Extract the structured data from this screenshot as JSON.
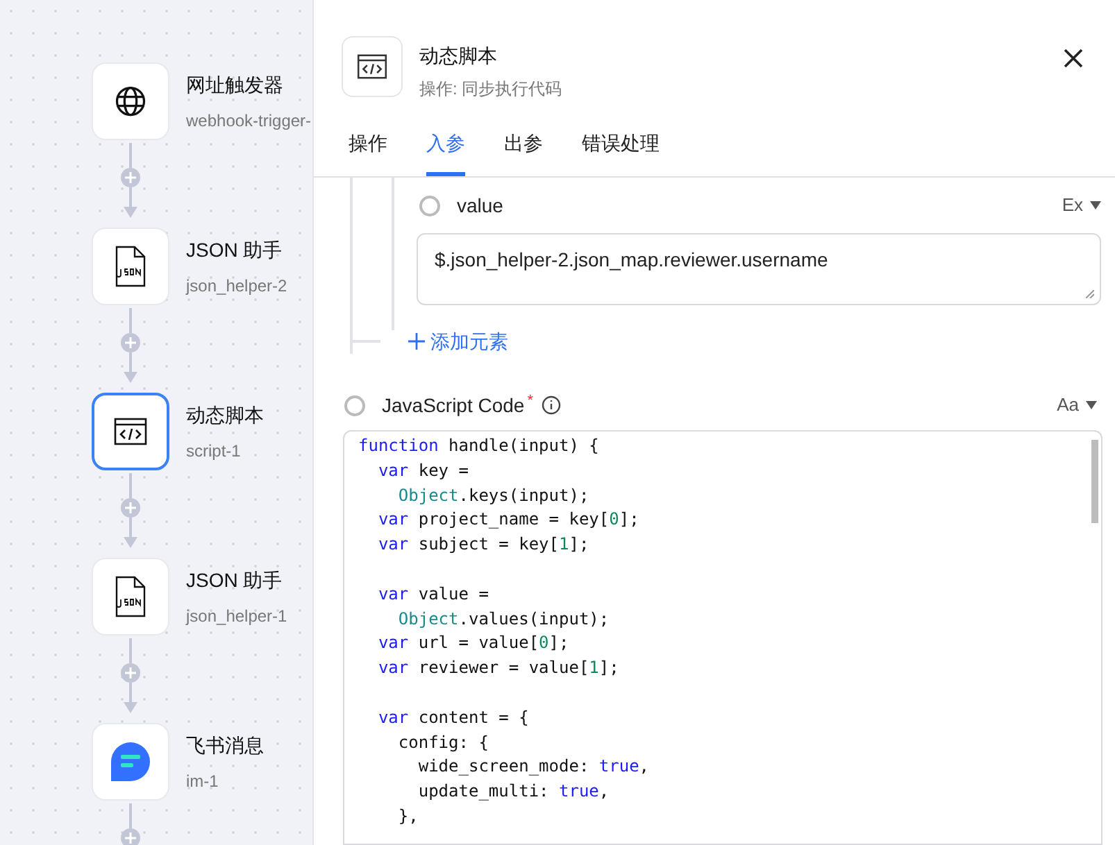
{
  "flow": {
    "nodes": [
      {
        "kind": "globe",
        "title": "网址触发器",
        "id": "webhook-trigger-",
        "selected": false
      },
      {
        "kind": "json",
        "title": "JSON 助手",
        "id": "json_helper-2",
        "selected": false
      },
      {
        "kind": "code",
        "title": "动态脚本",
        "id": "script-1",
        "selected": true
      },
      {
        "kind": "json",
        "title": "JSON 助手",
        "id": "json_helper-1",
        "selected": false
      },
      {
        "kind": "chat",
        "title": "飞书消息",
        "id": "im-1",
        "selected": false
      }
    ]
  },
  "panel": {
    "title": "动态脚本",
    "subtitle": "操作: 同步执行代码",
    "tabs": [
      {
        "label": "操作",
        "selected": false
      },
      {
        "label": "入参",
        "selected": true
      },
      {
        "label": "出参",
        "selected": false
      },
      {
        "label": "错误处理",
        "selected": false
      }
    ],
    "value_field": {
      "label": "value",
      "selected": false,
      "mode": "Ex",
      "value": "$.json_helper-2.json_map.reviewer.username"
    },
    "add_element": "添加元素",
    "code_field": {
      "label": "JavaScript Code",
      "selected": false,
      "required_mark": "*",
      "mode": "Aa",
      "lines": [
        {
          "kind": "code",
          "tokens": [
            {
              "kind": "kw",
              "text": "function"
            },
            {
              "kind": "plain",
              "text": " handle(input) {"
            }
          ]
        },
        {
          "kind": "code",
          "tokens": [
            {
              "kind": "kw",
              "text": "  var"
            },
            {
              "kind": "plain",
              "text": " key ="
            }
          ]
        },
        {
          "kind": "code",
          "tokens": [
            {
              "kind": "obj",
              "text": "    Object"
            },
            {
              "kind": "plain",
              "text": ".keys(input);"
            }
          ]
        },
        {
          "kind": "code",
          "tokens": [
            {
              "kind": "kw",
              "text": "  var"
            },
            {
              "kind": "plain",
              "text": " project_name = key["
            },
            {
              "kind": "num",
              "text": "0"
            },
            {
              "kind": "plain",
              "text": "];"
            }
          ]
        },
        {
          "kind": "code",
          "tokens": [
            {
              "kind": "kw",
              "text": "  var"
            },
            {
              "kind": "plain",
              "text": " subject = key["
            },
            {
              "kind": "num",
              "text": "1"
            },
            {
              "kind": "plain",
              "text": "];"
            }
          ]
        },
        {
          "kind": "blank"
        },
        {
          "kind": "code",
          "tokens": [
            {
              "kind": "kw",
              "text": "  var"
            },
            {
              "kind": "plain",
              "text": " value ="
            }
          ]
        },
        {
          "kind": "code",
          "tokens": [
            {
              "kind": "obj",
              "text": "    Object"
            },
            {
              "kind": "plain",
              "text": ".values(input);"
            }
          ]
        },
        {
          "kind": "code",
          "tokens": [
            {
              "kind": "kw",
              "text": "  var"
            },
            {
              "kind": "plain",
              "text": " url = value["
            },
            {
              "kind": "num",
              "text": "0"
            },
            {
              "kind": "plain",
              "text": "];"
            }
          ]
        },
        {
          "kind": "code",
          "tokens": [
            {
              "kind": "kw",
              "text": "  var"
            },
            {
              "kind": "plain",
              "text": " reviewer = value["
            },
            {
              "kind": "num",
              "text": "1"
            },
            {
              "kind": "plain",
              "text": "];"
            }
          ]
        },
        {
          "kind": "blank"
        },
        {
          "kind": "code",
          "tokens": [
            {
              "kind": "kw",
              "text": "  var"
            },
            {
              "kind": "plain",
              "text": " content = {"
            }
          ]
        },
        {
          "kind": "code",
          "tokens": [
            {
              "kind": "plain",
              "text": "    config: {"
            }
          ]
        },
        {
          "kind": "code",
          "tokens": [
            {
              "kind": "plain",
              "text": "      wide_screen_mode: "
            },
            {
              "kind": "kw",
              "text": "true"
            },
            {
              "kind": "plain",
              "text": ","
            }
          ]
        },
        {
          "kind": "code",
          "tokens": [
            {
              "kind": "plain",
              "text": "      update_multi: "
            },
            {
              "kind": "kw",
              "text": "true"
            },
            {
              "kind": "plain",
              "text": ","
            }
          ]
        },
        {
          "kind": "code",
          "tokens": [
            {
              "kind": "plain",
              "text": "    },"
            }
          ]
        }
      ]
    }
  }
}
